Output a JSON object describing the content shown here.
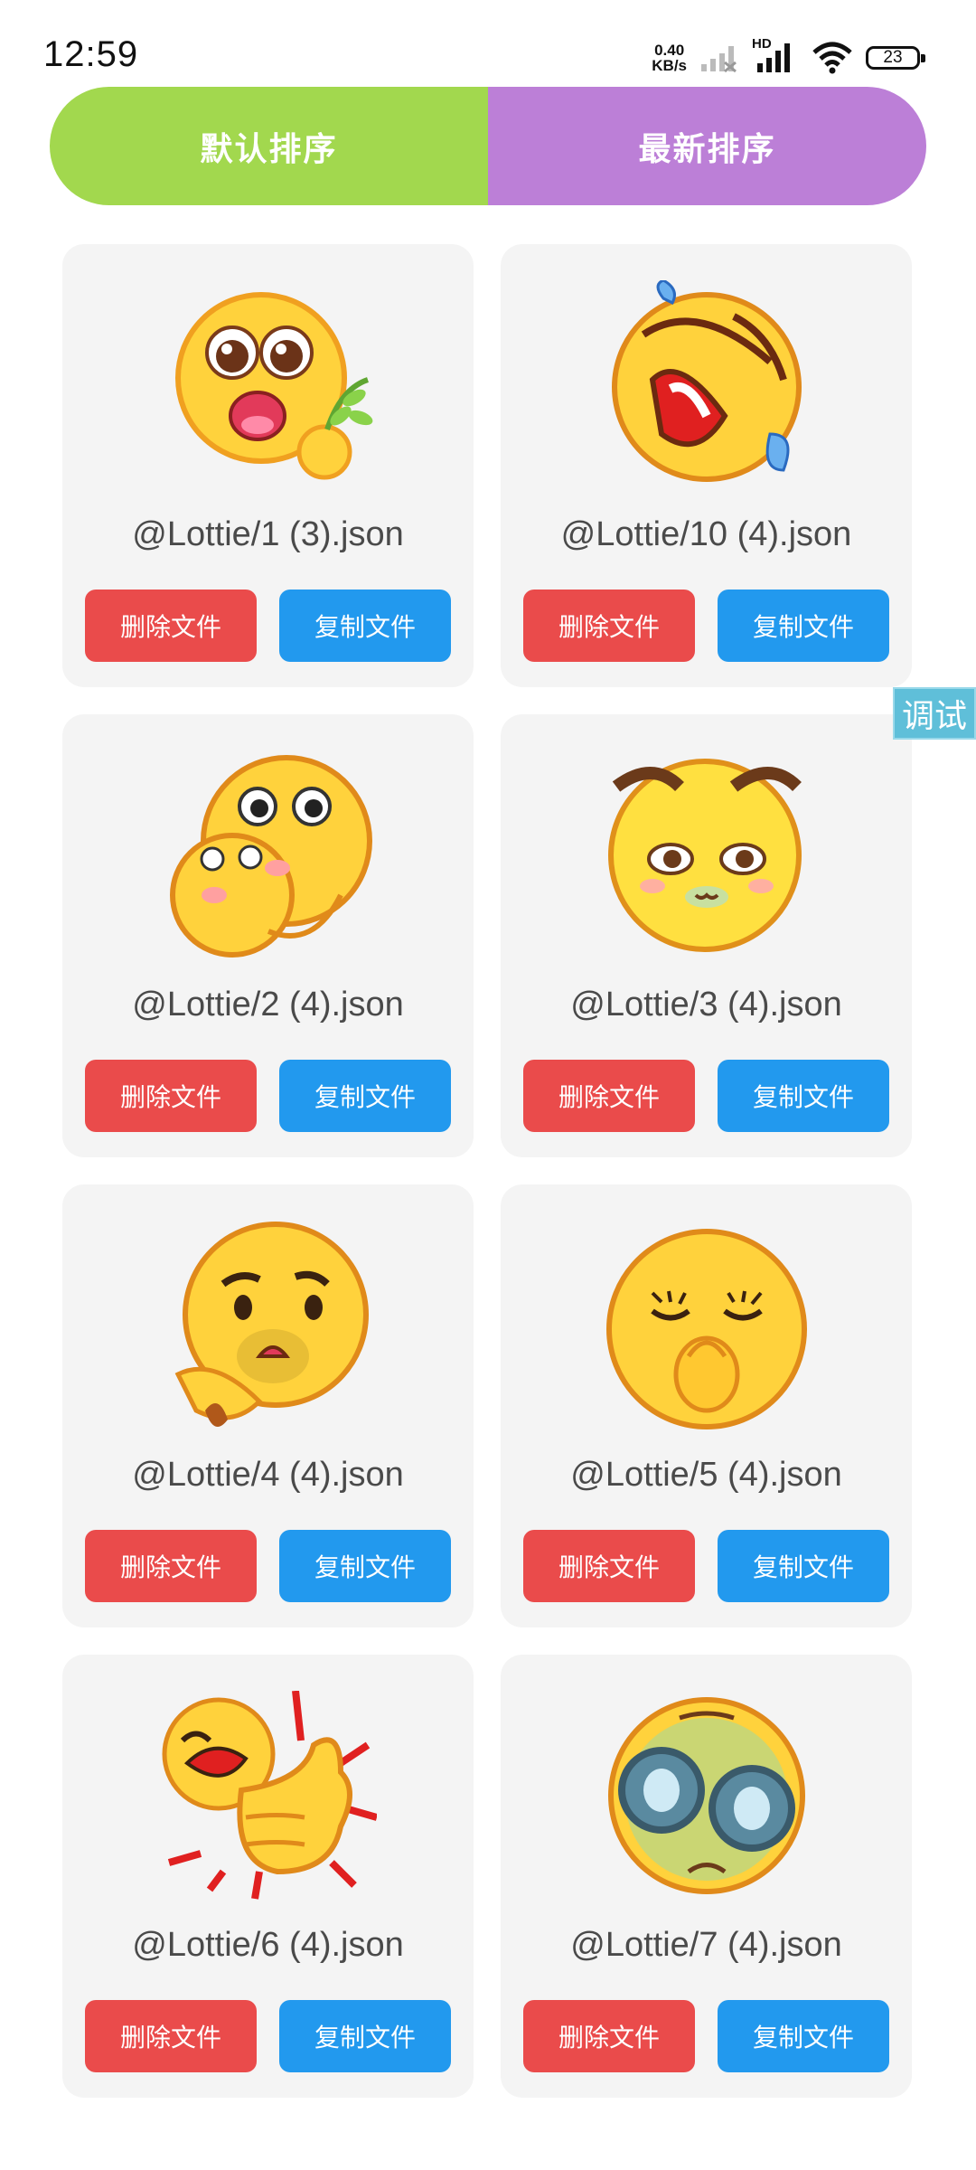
{
  "status": {
    "time": "12:59",
    "speed_value": "0.40",
    "speed_unit": "KB/s",
    "network_label": "HD",
    "battery": "23"
  },
  "sort": {
    "default_label": "默认排序",
    "latest_label": "最新排序",
    "default_color": "#a2d84e",
    "latest_color": "#bc7fd7"
  },
  "cards": [
    {
      "file": "@Lottie/1 (3).json",
      "delete_label": "删除文件",
      "copy_label": "复制文件",
      "emoji": "excited-face-with-leaf"
    },
    {
      "file": "@Lottie/10 (4).json",
      "delete_label": "删除文件",
      "copy_label": "复制文件",
      "emoji": "laughing-tears-face"
    },
    {
      "file": "@Lottie/2 (4).json",
      "delete_label": "删除文件",
      "copy_label": "复制文件",
      "emoji": "hugging-faces"
    },
    {
      "file": "@Lottie/3 (4).json",
      "delete_label": "删除文件",
      "copy_label": "复制文件",
      "emoji": "shy-face-with-brows"
    },
    {
      "file": "@Lottie/4 (4).json",
      "delete_label": "删除文件",
      "copy_label": "复制文件",
      "emoji": "thinking-face"
    },
    {
      "file": "@Lottie/5 (4).json",
      "delete_label": "删除文件",
      "copy_label": "复制文件",
      "emoji": "hand-on-mouth-face"
    },
    {
      "file": "@Lottie/6 (4).json",
      "delete_label": "删除文件",
      "copy_label": "复制文件",
      "emoji": "thumbs-up-laugh"
    },
    {
      "file": "@Lottie/7 (4).json",
      "delete_label": "删除文件",
      "copy_label": "复制文件",
      "emoji": "goggles-face"
    }
  ],
  "debug_label": "调试",
  "colors": {
    "delete": "#ea4b4b",
    "copy": "#2299ee",
    "card_bg": "#f4f4f4",
    "debug": "#5fbfd9"
  }
}
